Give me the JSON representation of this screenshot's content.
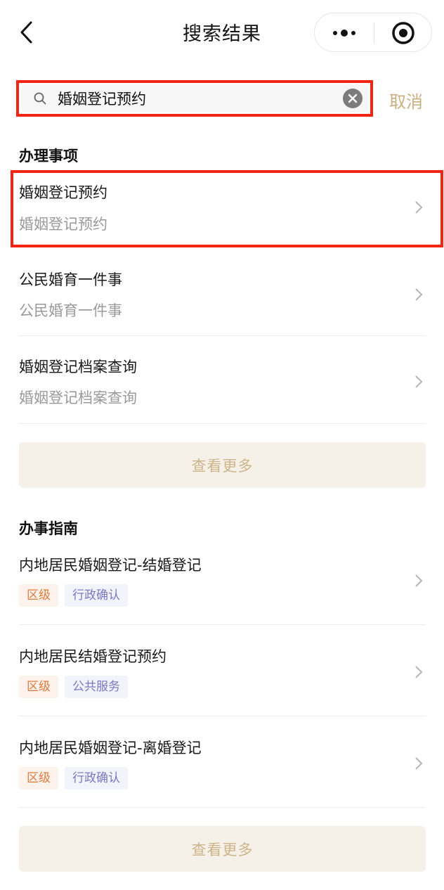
{
  "header": {
    "title": "搜索结果"
  },
  "search": {
    "value": "婚姻登记预约",
    "cancel_label": "取消"
  },
  "sections": {
    "services": {
      "title": "办理事项",
      "items": [
        {
          "title": "婚姻登记预约",
          "subtitle": "婚姻登记预约"
        },
        {
          "title": "公民婚育一件事",
          "subtitle": "公民婚育一件事"
        },
        {
          "title": "婚姻登记档案查询",
          "subtitle": "婚姻登记档案查询"
        }
      ],
      "more_label": "查看更多"
    },
    "guides": {
      "title": "办事指南",
      "items": [
        {
          "title": "内地居民婚姻登记-结婚登记",
          "tags": [
            "区级",
            "行政确认"
          ]
        },
        {
          "title": "内地居民结婚登记预约",
          "tags": [
            "区级",
            "公共服务"
          ]
        },
        {
          "title": "内地居民婚姻登记-离婚登记",
          "tags": [
            "区级",
            "行政确认"
          ]
        }
      ],
      "more_label": "查看更多"
    }
  },
  "colors": {
    "accent": "#c9b083",
    "highlight": "#f22513",
    "tag_level": "#e07a3c",
    "tag_type": "#7b78c4"
  }
}
